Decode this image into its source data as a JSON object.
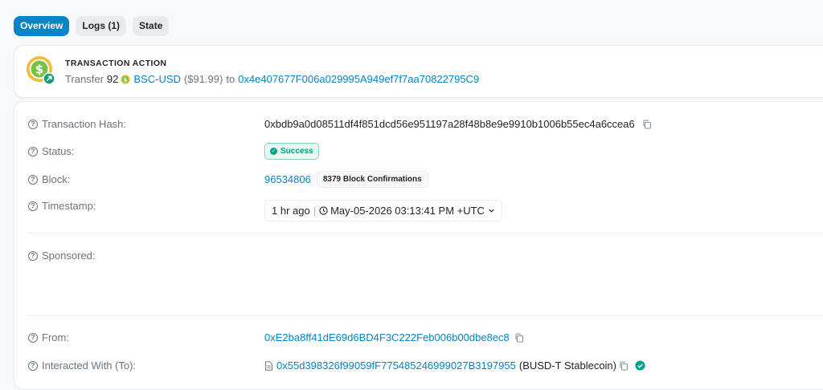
{
  "tabs": [
    {
      "label": "Overview",
      "active": true
    },
    {
      "label": "Logs (1)",
      "active": false
    },
    {
      "label": "State",
      "active": false
    }
  ],
  "action": {
    "title": "TRANSACTION ACTION",
    "verb": "Transfer",
    "amount": "92",
    "token": "BSC-USD",
    "usd": "($91.99)",
    "to_word": "to",
    "recipient": "0x4e407677F006a029995A949ef7f7aa70822795C9"
  },
  "details": {
    "hash": {
      "label": "Transaction Hash:",
      "value": "0xbdb9a0d08511df4f851dcd56e951197a28f48b8e9e9910b1006b55ec4a6ccea6"
    },
    "status": {
      "label": "Status:",
      "value": "Success"
    },
    "block": {
      "label": "Block:",
      "value": "96534806",
      "confirmations": "8379 Block Confirmations"
    },
    "timestamp": {
      "label": "Timestamp:",
      "ago": "1 hr ago",
      "sep": "|",
      "datetime": "May-05-2026 03:13:41 PM +UTC"
    },
    "sponsored": {
      "label": "Sponsored:"
    },
    "from": {
      "label": "From:",
      "value": "0xE2ba8ff41dE69d6BD4F3C222Feb006b00dbe8ec8"
    },
    "to": {
      "label": "Interacted With (To):",
      "value": "0x55d398326f99059fF775485246999027B3197955",
      "name": "(BUSD-T Stablecoin)"
    }
  },
  "colors": {
    "accent": "#0784c3",
    "success": "#00a186",
    "coin": "#f3ba2f"
  },
  "icons": [
    "coin-icon",
    "arrow-out-icon",
    "question-icon",
    "copy-icon",
    "check-circle-icon",
    "clock-icon",
    "chevron-down-icon",
    "contract-file-icon",
    "verified-check-icon"
  ]
}
